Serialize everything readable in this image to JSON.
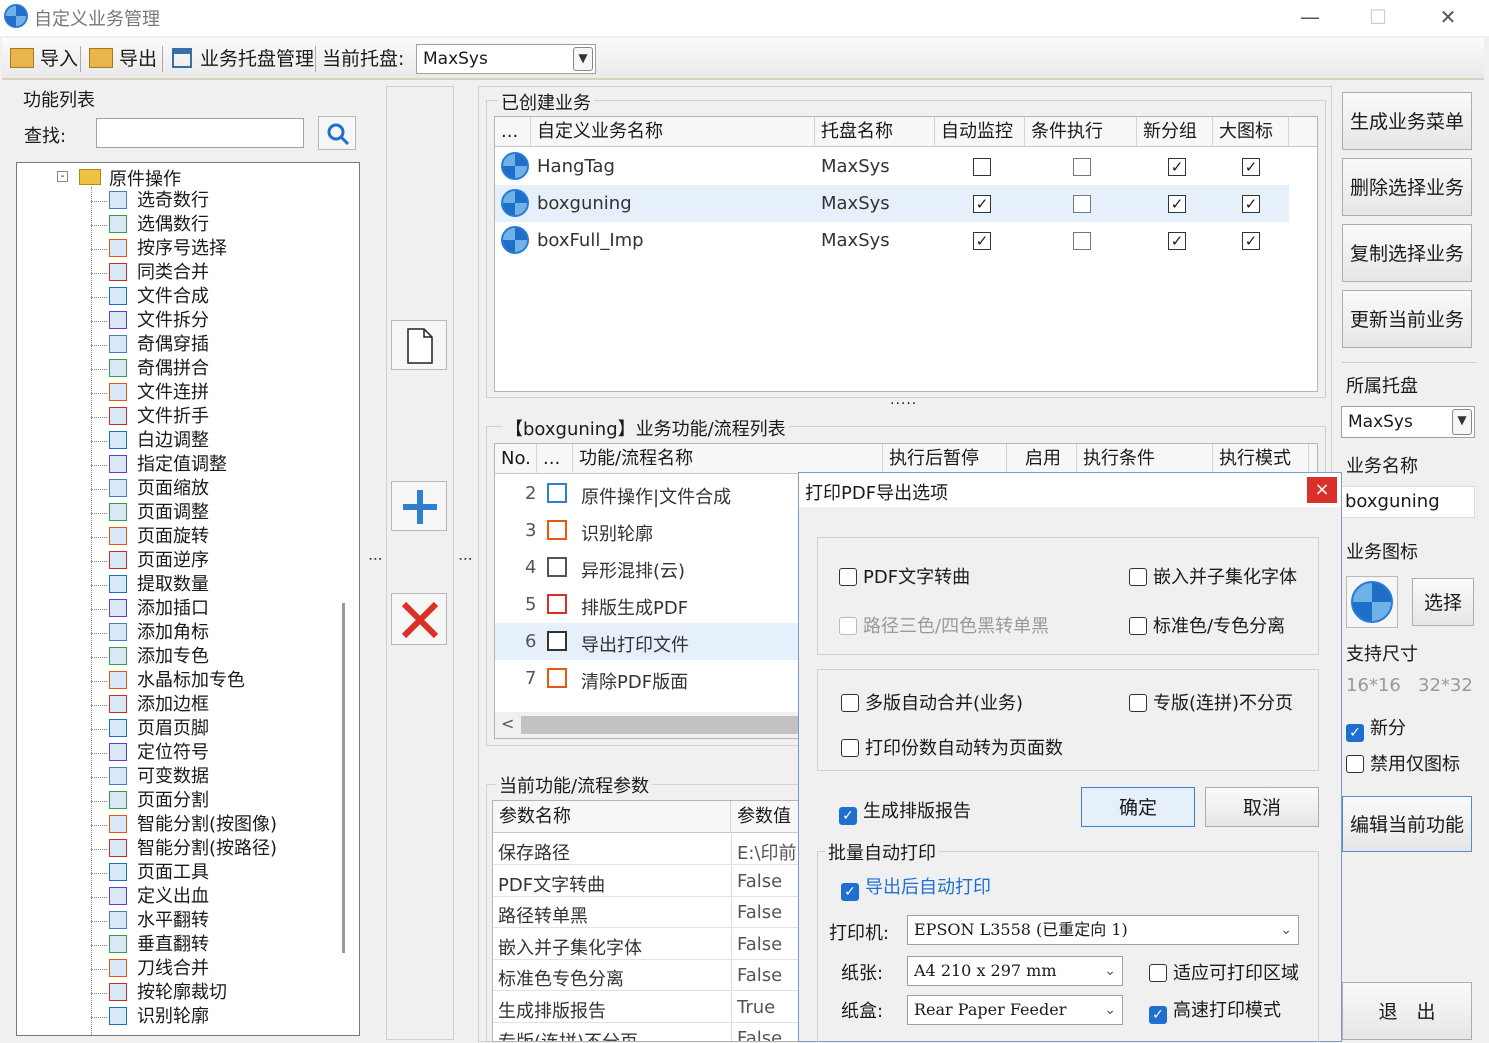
{
  "window": {
    "title": "自定义业务管理",
    "min": "—",
    "max": "☐",
    "close": "✕"
  },
  "toolbar": {
    "import": "导入",
    "export": "导出",
    "host_mgmt": "业务托盘管理",
    "current_host_label": "当前托盘:",
    "current_host": "MaxSys"
  },
  "func_list": {
    "title": "功能列表",
    "search_label": "查找:",
    "search_value": "",
    "root": "原件操作",
    "items": [
      "选奇数行",
      "选偶数行",
      "按序号选择",
      "同类合并",
      "文件合成",
      "文件拆分",
      "奇偶穿插",
      "奇偶拼合",
      "文件连拼",
      "文件折手",
      "白边调整",
      "指定值调整",
      "页面缩放",
      "页面调整",
      "页面旋转",
      "页面逆序",
      "提取数量",
      "添加插口",
      "添加角标",
      "添加专色",
      "水晶标加专色",
      "添加边框",
      "页眉页脚",
      "定位符号",
      "可变数据",
      "页面分割",
      "智能分割(按图像)",
      "智能分割(按路径)",
      "页面工具",
      "定义出血",
      "水平翻转",
      "垂直翻转",
      "刀线合并",
      "按轮廓裁切",
      "识别轮廓"
    ]
  },
  "created": {
    "title": "已创建业务",
    "headers": [
      "...",
      "自定义业务名称",
      "托盘名称",
      "自动监控",
      "条件执行",
      "新分组",
      "大图标"
    ],
    "rows": [
      {
        "name": "HangTag",
        "host": "MaxSys",
        "auto": false,
        "cond": false,
        "group": true,
        "big": true
      },
      {
        "name": "boxguning",
        "host": "MaxSys",
        "auto": true,
        "cond": false,
        "group": true,
        "big": true
      },
      {
        "name": "boxFull_Imp",
        "host": "MaxSys",
        "auto": true,
        "cond": false,
        "group": true,
        "big": true
      }
    ],
    "splitter": "....."
  },
  "flow": {
    "title": "【boxguning】业务功能/流程列表",
    "headers": [
      "No.",
      "...",
      "功能/流程名称",
      "执行后暂停",
      "启用",
      "执行条件",
      "执行模式"
    ],
    "rows": [
      {
        "no": "2",
        "name": "原件操作|文件合成"
      },
      {
        "no": "3",
        "name": "识别轮廓"
      },
      {
        "no": "4",
        "name": "异形混排(云)"
      },
      {
        "no": "5",
        "name": "排版生成PDF"
      },
      {
        "no": "6",
        "name": "导出打印文件"
      },
      {
        "no": "7",
        "name": "清除PDF版面"
      }
    ],
    "scroll_left": "<"
  },
  "params": {
    "title": "当前功能/流程参数",
    "headers": [
      "参数名称",
      "参数值"
    ],
    "rows": [
      {
        "name": "保存路径",
        "value": "E:\\印前"
      },
      {
        "name": "PDF文字转曲",
        "value": "False"
      },
      {
        "name": "路径转单黑",
        "value": "False"
      },
      {
        "name": "嵌入并子集化字体",
        "value": "False"
      },
      {
        "name": "标准色专色分离",
        "value": "False"
      },
      {
        "name": "生成排版报告",
        "value": "True"
      },
      {
        "name": "专版(连拼)不分页",
        "value": "False"
      }
    ]
  },
  "right": {
    "gen_menu": "生成业务菜单",
    "delete_sel": "删除选择业务",
    "copy_sel": "复制选择业务",
    "update_cur": "更新当前业务",
    "host_label": "所属托盘",
    "host_value": "MaxSys",
    "name_label": "业务名称",
    "name_value": "boxguning",
    "icon_label": "业务图标",
    "choose": "选择",
    "size_label": "支持尺寸",
    "size1": "16*16",
    "size2": "32*32",
    "new_group": "新分",
    "icon_only": "禁用仅图标",
    "edit_func": "编辑当前功能",
    "exit": "退　出"
  },
  "dialog": {
    "title": "打印PDF导出选项",
    "close": "×",
    "opt_text_curve": "PDF文字转曲",
    "opt_embed": "嵌入并子集化字体",
    "opt_path": "路径三色/四色黑转单黑",
    "opt_sep": "标准色/专色分离",
    "opt_merge": "多版自动合并(业务)",
    "opt_nopage": "专版(连拼)不分页",
    "opt_copies": "打印份数自动转为页面数",
    "opt_report": "生成排版报告",
    "ok": "确定",
    "cancel": "取消",
    "batch_title": "批量自动打印",
    "auto_print": "导出后自动打印",
    "printer_label": "打印机:",
    "printer": "EPSON L3558 (已重定向 1)",
    "paper_label": "纸张:",
    "paper": "A4 210 x 297 mm",
    "fit": "适应可打印区域",
    "tray_label": "纸盒:",
    "tray": "Rear Paper Feeder",
    "fast": "高速打印模式"
  },
  "colors": {
    "accent": "#1e6fd0",
    "selected_row": "#e5f0fb",
    "add": "#2f7fd0",
    "delete": "#d93025"
  }
}
